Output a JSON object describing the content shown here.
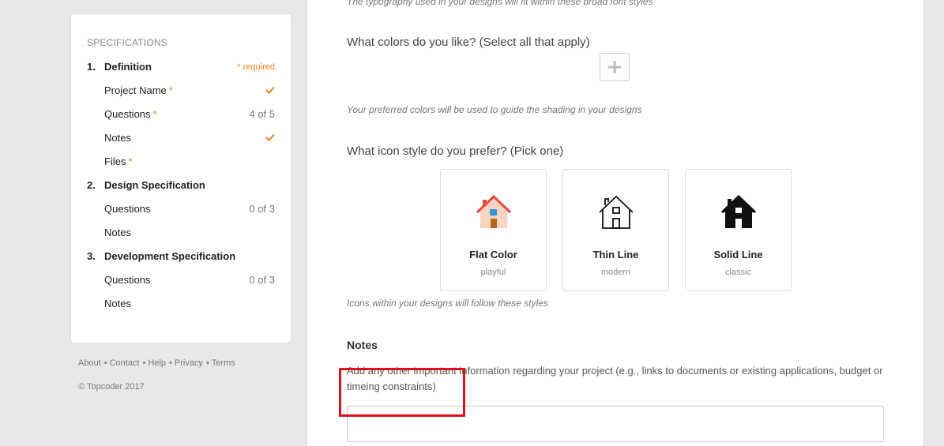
{
  "sidebar": {
    "heading": "SPECIFICATIONS",
    "required_label": "* required",
    "sections": [
      {
        "number": "1.",
        "title": "Definition",
        "items": [
          {
            "label": "Project Name",
            "required": "*",
            "status": "check"
          },
          {
            "label": "Questions",
            "required": "*",
            "status": "4 of 5"
          },
          {
            "label": "Notes",
            "status": "check"
          },
          {
            "label": "Files",
            "required": "*"
          }
        ]
      },
      {
        "number": "2.",
        "title": "Design Specification",
        "items": [
          {
            "label": "Questions",
            "status": "0 of 3"
          },
          {
            "label": "Notes"
          }
        ]
      },
      {
        "number": "3.",
        "title": "Development Specification",
        "items": [
          {
            "label": "Questions",
            "status": "0 of 3"
          },
          {
            "label": "Notes"
          }
        ]
      }
    ]
  },
  "footer": {
    "links": [
      "About",
      "Contact",
      "Help",
      "Privacy",
      "Terms"
    ],
    "copyright": "© Topcoder 2017"
  },
  "main": {
    "typography_hint": "The typography used in your designs will fit within these broad font styles",
    "colors_question": "What colors do you like? (Select all that apply)",
    "colors_hint": "Your preferred colors will be used to guide the shading in your designs",
    "icon_question": "What icon style do you prefer? (Pick one)",
    "icon_options": [
      {
        "title": "Flat Color",
        "subtitle": "playful",
        "icon": "house-flat-color-icon"
      },
      {
        "title": "Thin Line",
        "subtitle": "modern",
        "icon": "house-thin-line-icon"
      },
      {
        "title": "Solid Line",
        "subtitle": "classic",
        "icon": "house-solid-line-icon"
      }
    ],
    "icon_hint": "Icons within your designs will follow these styles",
    "notes_title": "Notes",
    "notes_description": "Add any other important information regarding your project (e.g., links to documents or existing applications, budget or timeing constraints)",
    "notes_value": ""
  },
  "colors": {
    "accent": "#f07d1e",
    "highlight": "#e0101a"
  }
}
